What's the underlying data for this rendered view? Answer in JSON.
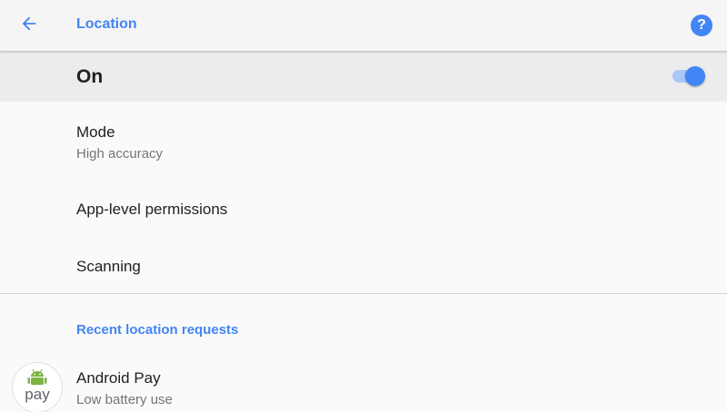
{
  "appbar": {
    "title": "Location",
    "back_icon": "arrow-back-icon",
    "help_icon": "help-icon",
    "help_glyph": "?"
  },
  "master_switch": {
    "label": "On",
    "checked": true
  },
  "settings": {
    "mode": {
      "title": "Mode",
      "subtitle": "High accuracy"
    },
    "app_permissions": {
      "title": "App-level permissions"
    },
    "scanning": {
      "title": "Scanning"
    }
  },
  "recent_requests": {
    "header": "Recent location requests",
    "apps": [
      {
        "name": "Android Pay",
        "detail": "Low battery use",
        "icon": "android-pay-icon",
        "icon_text": "pay"
      }
    ]
  },
  "colors": {
    "accent": "#4285f4",
    "switch_track": "#aac7fa",
    "android_green": "#7cb342"
  }
}
